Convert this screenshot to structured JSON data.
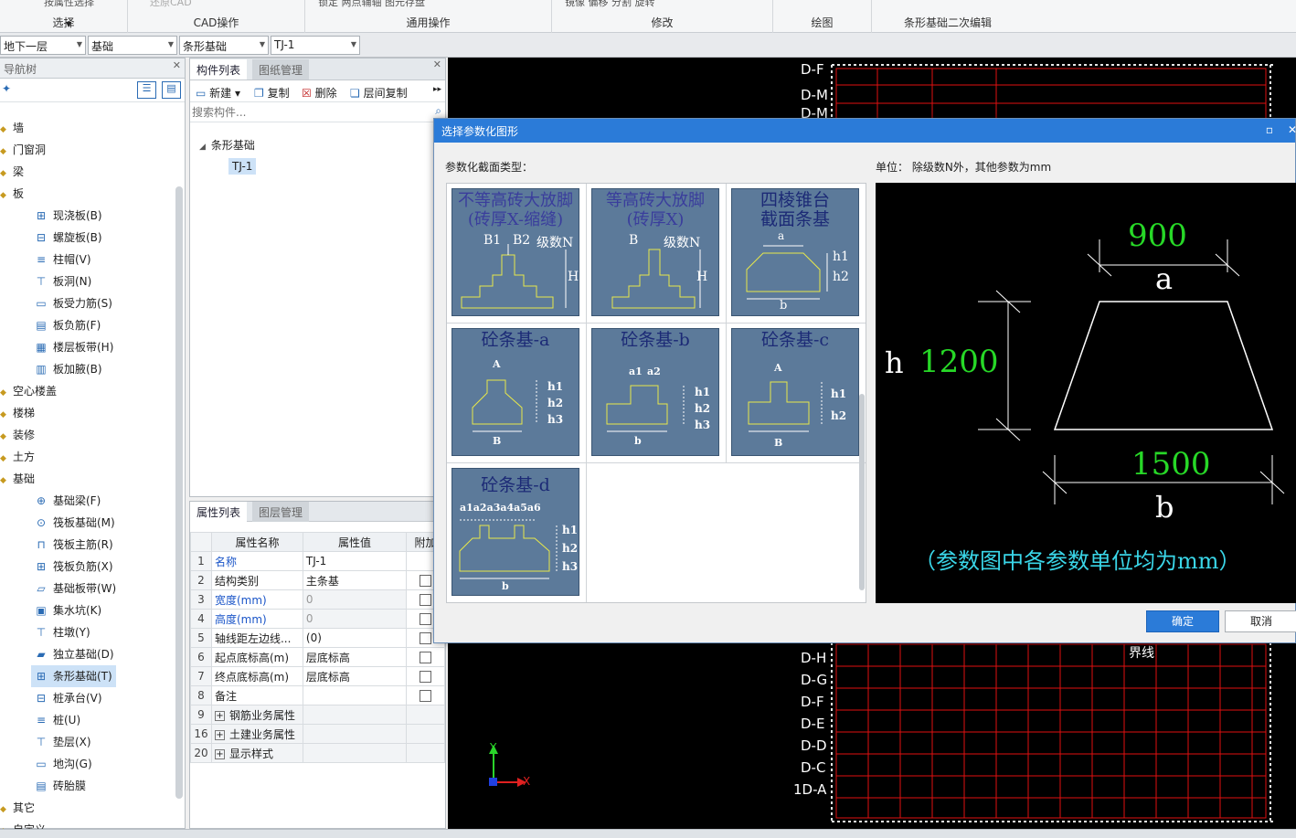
{
  "ribbon": {
    "groups": [
      {
        "label": "选择",
        "top": "按属性选择"
      },
      {
        "label": "CAD操作",
        "top": "还原CAD"
      },
      {
        "label": "通用操作",
        "top": "锁定   两点辅轴   图元存盘"
      },
      {
        "label": "修改",
        "top": "镜像   偏移   分割   旋转"
      },
      {
        "label": "绘图",
        "top": ""
      },
      {
        "label": "条形基础二次编辑",
        "top": ""
      }
    ]
  },
  "toolbar2": {
    "floor": "地下一层",
    "category": "基础",
    "type": "条形基础",
    "component": "TJ-1"
  },
  "nav": {
    "title": "导航树",
    "items": [
      {
        "label": "墙",
        "level": 0
      },
      {
        "label": "门窗洞",
        "level": 0
      },
      {
        "label": "梁",
        "level": 0
      },
      {
        "label": "板",
        "level": 0
      },
      {
        "label": "现浇板(B)",
        "level": 1
      },
      {
        "label": "螺旋板(B)",
        "level": 1
      },
      {
        "label": "柱帽(V)",
        "level": 1
      },
      {
        "label": "板洞(N)",
        "level": 1
      },
      {
        "label": "板受力筋(S)",
        "level": 1
      },
      {
        "label": "板负筋(F)",
        "level": 1
      },
      {
        "label": "楼层板带(H)",
        "level": 1
      },
      {
        "label": "板加腋(B)",
        "level": 1
      },
      {
        "label": "空心楼盖",
        "level": 0
      },
      {
        "label": "楼梯",
        "level": 0
      },
      {
        "label": "装修",
        "level": 0
      },
      {
        "label": "土方",
        "level": 0
      },
      {
        "label": "基础",
        "level": 0
      },
      {
        "label": "基础梁(F)",
        "level": 1
      },
      {
        "label": "筏板基础(M)",
        "level": 1
      },
      {
        "label": "筏板主筋(R)",
        "level": 1
      },
      {
        "label": "筏板负筋(X)",
        "level": 1
      },
      {
        "label": "基础板带(W)",
        "level": 1
      },
      {
        "label": "集水坑(K)",
        "level": 1
      },
      {
        "label": "柱墩(Y)",
        "level": 1
      },
      {
        "label": "独立基础(D)",
        "level": 1
      },
      {
        "label": "条形基础(T)",
        "level": 1,
        "selected": true
      },
      {
        "label": "桩承台(V)",
        "level": 1
      },
      {
        "label": "桩(U)",
        "level": 1
      },
      {
        "label": "垫层(X)",
        "level": 1
      },
      {
        "label": "地沟(G)",
        "level": 1
      },
      {
        "label": "砖胎膜",
        "level": 1
      },
      {
        "label": "其它",
        "level": 0
      },
      {
        "label": "自定义",
        "level": 0
      }
    ]
  },
  "comp": {
    "tab1": "构件列表",
    "tab2": "图纸管理",
    "new": "新建",
    "copy": "复制",
    "delete": "删除",
    "floorcopy": "层间复制",
    "search_placeholder": "搜索构件...",
    "tree_root": "条形基础",
    "tree_child": "TJ-1"
  },
  "props": {
    "tab1": "属性列表",
    "tab2": "图层管理",
    "col_name": "属性名称",
    "col_value": "属性值",
    "col_add": "附加",
    "rows": [
      {
        "i": "1",
        "name": "名称",
        "value": "TJ-1",
        "blue": true,
        "chk": false
      },
      {
        "i": "2",
        "name": "结构类别",
        "value": "主条基",
        "chk": true
      },
      {
        "i": "3",
        "name": "宽度(mm)",
        "value": "0",
        "blue": true,
        "gray": true,
        "chk": true
      },
      {
        "i": "4",
        "name": "高度(mm)",
        "value": "0",
        "blue": true,
        "gray": true,
        "chk": true
      },
      {
        "i": "5",
        "name": "轴线距左边线...",
        "value": "(0)",
        "chk": true
      },
      {
        "i": "6",
        "name": "起点底标高(m)",
        "value": "层底标高",
        "chk": true
      },
      {
        "i": "7",
        "name": "终点底标高(m)",
        "value": "层底标高",
        "chk": true
      },
      {
        "i": "8",
        "name": "备注",
        "value": "",
        "chk": true
      },
      {
        "i": "9",
        "name": "钢筋业务属性",
        "value": "",
        "group": true
      },
      {
        "i": "16",
        "name": "土建业务属性",
        "value": "",
        "group": true
      },
      {
        "i": "20",
        "name": "显示样式",
        "value": "",
        "group": true
      }
    ]
  },
  "cad": {
    "labels_left": [
      "D-F",
      "D-M",
      "D-M",
      "D-H",
      "D-G",
      "D-F",
      "D-E",
      "D-D",
      "D-C",
      "1D-A"
    ],
    "boundary_label": "界线",
    "axis_x": "X",
    "axis_y": "Y"
  },
  "dialog": {
    "title": "选择参数化图形",
    "section_label": "参数化截面类型：",
    "unit_label": "单位：  除级数N外，其他参数为mm",
    "ok": "确定",
    "cancel": "取消",
    "tiles": [
      {
        "title": "不等高砖大放脚\n(砖厚X-缩缝)",
        "labels": [
          "B1",
          "B2",
          "级数N",
          "H"
        ]
      },
      {
        "title": "等高砖大放脚\n(砖厚X)",
        "labels": [
          "B",
          "级数N",
          "H"
        ]
      },
      {
        "title": "四棱锥台\n截面条基",
        "labels": [
          "a",
          "h1",
          "h2",
          "b"
        ]
      },
      {
        "title": "砼条基-a",
        "labels": [
          "A",
          "h1",
          "h2",
          "h3",
          "B"
        ]
      },
      {
        "title": "砼条基-b",
        "labels": [
          "a1",
          "a2",
          "h1",
          "h2",
          "h3",
          "b"
        ]
      },
      {
        "title": "砼条基-c",
        "labels": [
          "A",
          "h1",
          "h2",
          "B"
        ]
      },
      {
        "title": "砼条基-d",
        "labels": [
          "a1a2a3a4a5a6",
          "h1",
          "h2",
          "h3",
          "b"
        ]
      }
    ],
    "preview": {
      "a_val": "900",
      "a_label": "a",
      "h_label": "h",
      "h_val": "1200",
      "b_val": "1500",
      "b_label": "b",
      "note": "（参数图中各参数单位均为mm）"
    }
  },
  "colors": {
    "accent": "#2b7bd8",
    "cad_grid": "#e01010",
    "dim_green": "#27d827",
    "note_cyan": "#3ad6e8",
    "tile_bg": "#5c7a9a"
  }
}
